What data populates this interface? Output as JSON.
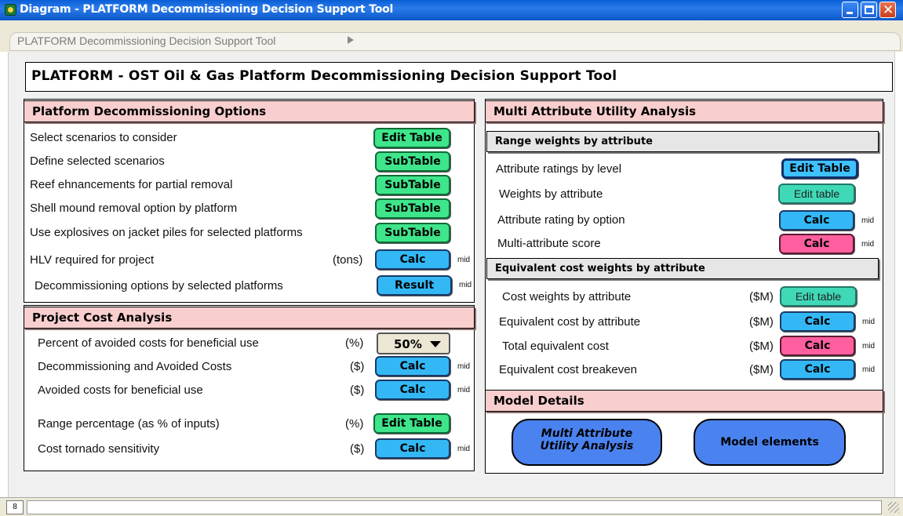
{
  "window": {
    "title": "Diagram - PLATFORM Decommissioning Decision Support Tool",
    "app_icon": "app-icon",
    "buttons": [
      "minimize-icon",
      "maximize-icon",
      "close-icon"
    ],
    "close_glyph": "✕"
  },
  "breadcrumb": {
    "label": "PLATFORM Decommissioning Decision Support Tool",
    "arrow_icon": "play-arrow-icon"
  },
  "main_title": "PLATFORM - OST Oil & Gas Platform Decommissioning Decision Support Tool",
  "options_panel": {
    "header": "Platform Decommissioning Options",
    "rows": [
      {
        "label": "Select scenarios to consider",
        "unit": "",
        "button": "Edit Table",
        "mid": ""
      },
      {
        "label": "Define selected scenarios",
        "unit": "",
        "button": "SubTable",
        "mid": ""
      },
      {
        "label": "Reef ehnancements for partial removal",
        "unit": "",
        "button": "SubTable",
        "mid": ""
      },
      {
        "label": "Shell mound removal option by platform",
        "unit": "",
        "button": "SubTable",
        "mid": ""
      },
      {
        "label": "Use explosives on jacket piles for selected platforms",
        "unit": "",
        "button": "SubTable",
        "mid": ""
      },
      {
        "label": "HLV required for project",
        "unit": "(tons)",
        "button": "Calc",
        "mid": "mid"
      },
      {
        "label": "Decommissioning options by selected platforms",
        "unit": "",
        "button": "Result",
        "mid": "mid"
      }
    ]
  },
  "cost_panel": {
    "header": "Project Cost Analysis",
    "rows": [
      {
        "label": "Percent of avoided costs for beneficial use",
        "unit": "(%)",
        "dropdown": "50%"
      },
      {
        "label": "Decommissioning and Avoided Costs",
        "unit": "($)",
        "button": "Calc",
        "mid": "mid"
      },
      {
        "label": "Avoided costs for beneficial use",
        "unit": "($)",
        "button": "Calc",
        "mid": "mid"
      },
      {
        "label": "Range percentage (as % of inputs)",
        "unit": "(%)",
        "button": "Edit Table",
        "mid": ""
      },
      {
        "label": "Cost tornado sensitivity",
        "unit": "($)",
        "button": "Calc",
        "mid": "mid"
      }
    ]
  },
  "maua_panel": {
    "header": "Multi Attribute Utility Analysis",
    "range_header": "Range weights by attribute",
    "range_rows": [
      {
        "label": "Attribute ratings by level",
        "button": "Edit Table",
        "mid": ""
      },
      {
        "label": "Weights by attribute",
        "button": "Edit table",
        "mid": ""
      },
      {
        "label": "Attribute rating by option",
        "button": "Calc",
        "mid": "mid"
      },
      {
        "label": "Multi-attribute score",
        "button": "Calc",
        "mid": "mid"
      }
    ],
    "equiv_header": "Equivalent cost weights by attribute",
    "equiv_rows": [
      {
        "label": "Cost weights by attribute",
        "unit": "($M)",
        "button": "Edit table",
        "mid": ""
      },
      {
        "label": "Equivalent cost by attribute",
        "unit": "($M)",
        "button": "Calc",
        "mid": "mid"
      },
      {
        "label": "Total equivalent cost",
        "unit": "($M)",
        "button": "Calc",
        "mid": "mid"
      },
      {
        "label": "Equivalent cost breakeven",
        "unit": "($M)",
        "button": "Calc",
        "mid": "mid"
      }
    ]
  },
  "model_panel": {
    "header": "Model Details",
    "button1_line1": "Multi Attribute",
    "button1_line2": "Utility Analysis",
    "button2": "Model elements"
  },
  "statusbar": {
    "indicator": "8"
  }
}
